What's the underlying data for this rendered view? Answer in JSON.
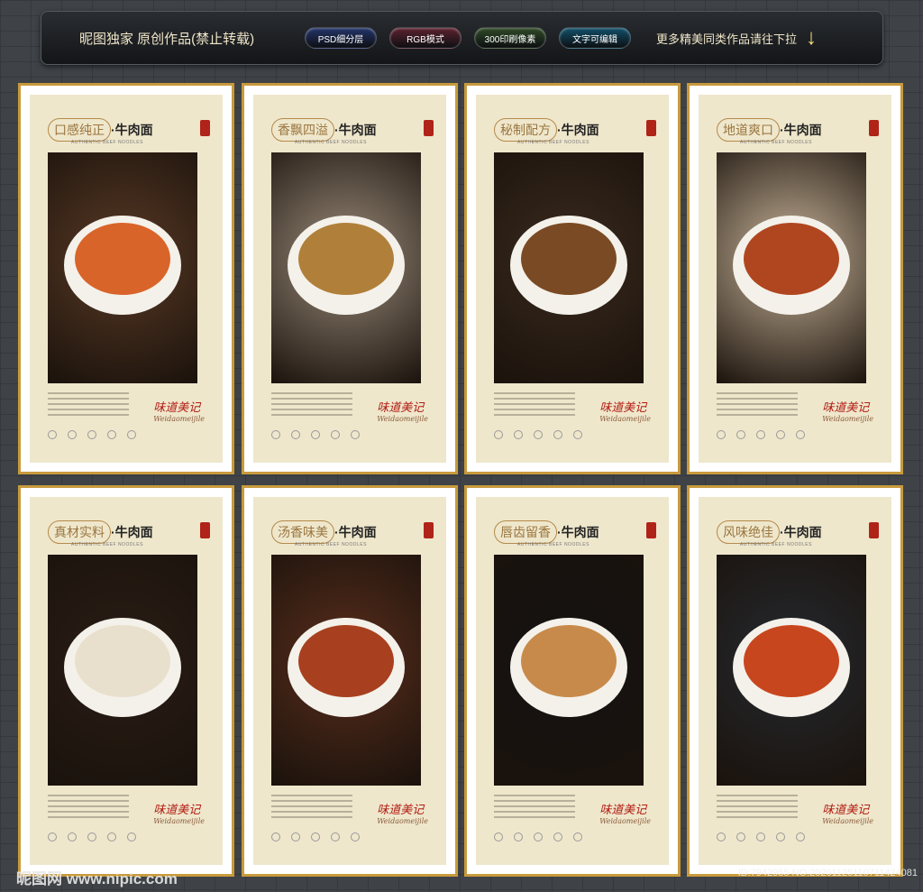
{
  "header": {
    "title": "昵图独家 原创作品(禁止转载)",
    "pills": [
      {
        "label": "PSD细分层",
        "color": "#24346a"
      },
      {
        "label": "RGB模式",
        "color": "#5c2330"
      },
      {
        "label": "300印刷像素",
        "color": "#2f4a26"
      },
      {
        "label": "文字可编辑",
        "color": "#12506a"
      }
    ],
    "more_label": "更多精美同类作品请往下拉",
    "arrow_icon": "↓"
  },
  "posters": [
    {
      "title": "口感纯正",
      "suffix": "·牛肉面",
      "english": "AUTHENTIC BEEF NOODLES",
      "bg": "#5a3a25",
      "bowl": "#d9642a"
    },
    {
      "title": "香飘四溢",
      "suffix": "·牛肉面",
      "english": "AUTHENTIC BEEF NOODLES",
      "bg": "#9b8c7b",
      "bowl": "#b0803a"
    },
    {
      "title": "秘制配方",
      "suffix": "·牛肉面",
      "english": "AUTHENTIC BEEF NOODLES",
      "bg": "#3a2a1e",
      "bowl": "#7a4a24"
    },
    {
      "title": "地道爽口",
      "suffix": "·牛肉面",
      "english": "AUTHENTIC BEEF NOODLES",
      "bg": "#c9b59a",
      "bowl": "#b0461f"
    },
    {
      "title": "真材实料",
      "suffix": "·牛肉面",
      "english": "AUTHENTIC BEEF NOODLES",
      "bg": "#2a1e16",
      "bowl": "#e8e0cc"
    },
    {
      "title": "汤香味美",
      "suffix": "·牛肉面",
      "english": "AUTHENTIC BEEF NOODLES",
      "bg": "#5a2e1c",
      "bowl": "#a8401f"
    },
    {
      "title": "唇齿留香",
      "suffix": "·牛肉面",
      "english": "AUTHENTIC BEEF NOODLES",
      "bg": "#141212",
      "bowl": "#c88a4a"
    },
    {
      "title": "风味绝佳",
      "suffix": "·牛肉面",
      "english": "AUTHENTIC BEEF NOODLES",
      "bg": "#262a30",
      "bowl": "#c8461e"
    }
  ],
  "poster_logo": {
    "cn": "味道美记",
    "en": "Weidaomeijile"
  },
  "watermark": {
    "left": "昵图网 www.nipic.com",
    "right": "ID:7942955 NO:20201125110711424081"
  }
}
